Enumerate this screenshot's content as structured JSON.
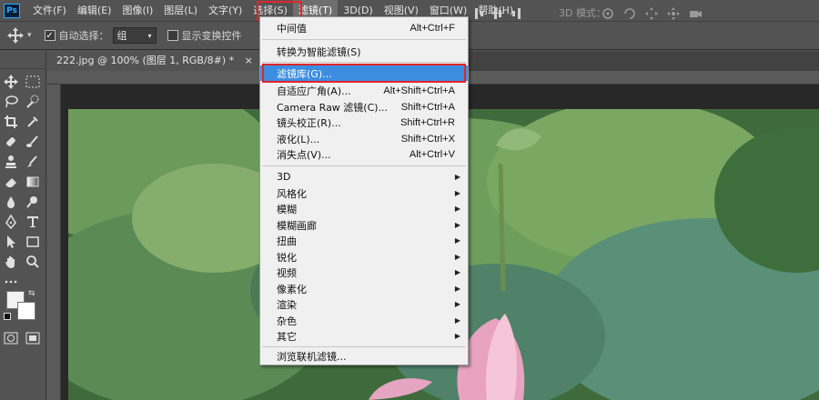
{
  "app": {
    "logo": "Ps"
  },
  "menubar": {
    "items": [
      "文件(F)",
      "编辑(E)",
      "图像(I)",
      "图层(L)",
      "文字(Y)",
      "选择(S)",
      "滤镜(T)",
      "3D(D)",
      "视图(V)",
      "窗口(W)",
      "帮助(H)"
    ],
    "active": "滤镜(T)"
  },
  "options": {
    "auto_select_label": "自动选择：",
    "auto_select_value": "组",
    "show_transform_label": "显示变换控件",
    "mode_3d_label": "3D 模式："
  },
  "document": {
    "tab_title": "222.jpg @ 100% (图层 1, RGB/8#) *",
    "close_symbol": "×"
  },
  "filter_menu": {
    "items": [
      {
        "label": "中间值",
        "shortcut": "Alt+Ctrl+F"
      },
      {
        "label": "转换为智能滤镜(S)",
        "shortcut": ""
      },
      {
        "label": "滤镜库(G)...",
        "shortcut": "",
        "selected": true
      },
      {
        "label": "自适应广角(A)...",
        "shortcut": "Alt+Shift+Ctrl+A"
      },
      {
        "label": "Camera Raw 滤镜(C)...",
        "shortcut": "Shift+Ctrl+A"
      },
      {
        "label": "镜头校正(R)...",
        "shortcut": "Shift+Ctrl+R"
      },
      {
        "label": "液化(L)...",
        "shortcut": "Shift+Ctrl+X"
      },
      {
        "label": "消失点(V)...",
        "shortcut": "Alt+Ctrl+V"
      },
      {
        "label": "3D",
        "submenu": true
      },
      {
        "label": "风格化",
        "submenu": true
      },
      {
        "label": "模糊",
        "submenu": true
      },
      {
        "label": "模糊画廊",
        "submenu": true
      },
      {
        "label": "扭曲",
        "submenu": true
      },
      {
        "label": "锐化",
        "submenu": true
      },
      {
        "label": "视频",
        "submenu": true
      },
      {
        "label": "像素化",
        "submenu": true
      },
      {
        "label": "渲染",
        "submenu": true
      },
      {
        "label": "杂色",
        "submenu": true
      },
      {
        "label": "其它",
        "submenu": true
      },
      {
        "label": "浏览联机滤镜...",
        "shortcut": ""
      }
    ]
  },
  "colors": {
    "ui_bg": "#535353",
    "menu_bg": "#f0f0f0",
    "selection": "#3d8ee0",
    "highlight_box": "#e0262c"
  }
}
